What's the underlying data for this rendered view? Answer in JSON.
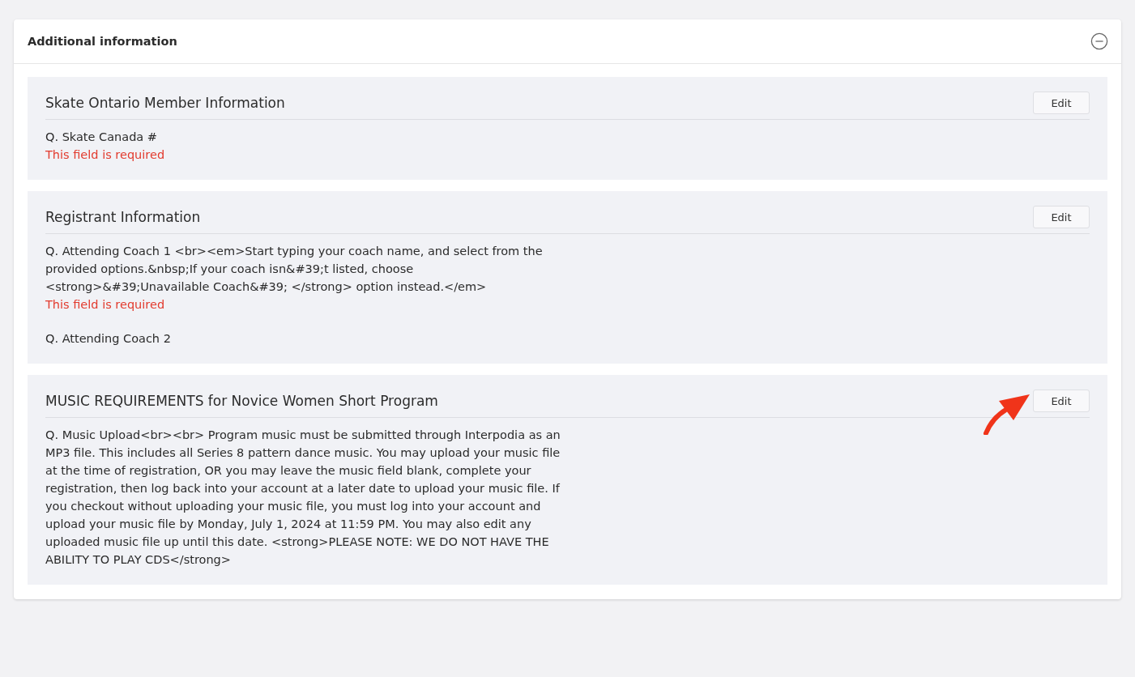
{
  "panel": {
    "title": "Additional information",
    "expanded": true
  },
  "sections": [
    {
      "title": "Skate Ontario Member Information",
      "button": "Edit",
      "highlighted": false,
      "questions": [
        {
          "question": "Q. Skate Canada #",
          "error": "This field is required"
        }
      ]
    },
    {
      "title": "Registrant Information",
      "button": "Edit",
      "highlighted": false,
      "questions": [
        {
          "question": "Q. Attending Coach 1 <br><em>Start typing your coach name, and select from the provided options.&nbsp;If your coach isn&#39;t listed, choose <strong>&#39;Unavailable Coach&#39; </strong> option instead.</em>",
          "error": "This field is required"
        },
        {
          "question": "Q. Attending Coach 2"
        }
      ]
    },
    {
      "title": "MUSIC REQUIREMENTS for Novice Women Short Program",
      "button": "Edit",
      "highlighted": true,
      "questions": [
        {
          "question": "Q. Music Upload<br><br> Program music must be submitted through Interpodia as an MP3 file. This includes all Series 8 pattern dance music. You may upload your music file at the time of registration, OR you may leave the music field blank, complete your registration, then log back into your account at a later date to upload your music file. If you checkout without uploading your music file, you must log into your account and upload your music file by Monday, July 1, 2024 at 11:59 PM. You may also edit any uploaded music file up until this date. <strong>PLEASE NOTE: WE DO NOT HAVE THE ABILITY TO PLAY CDS</strong>"
        }
      ]
    }
  ]
}
